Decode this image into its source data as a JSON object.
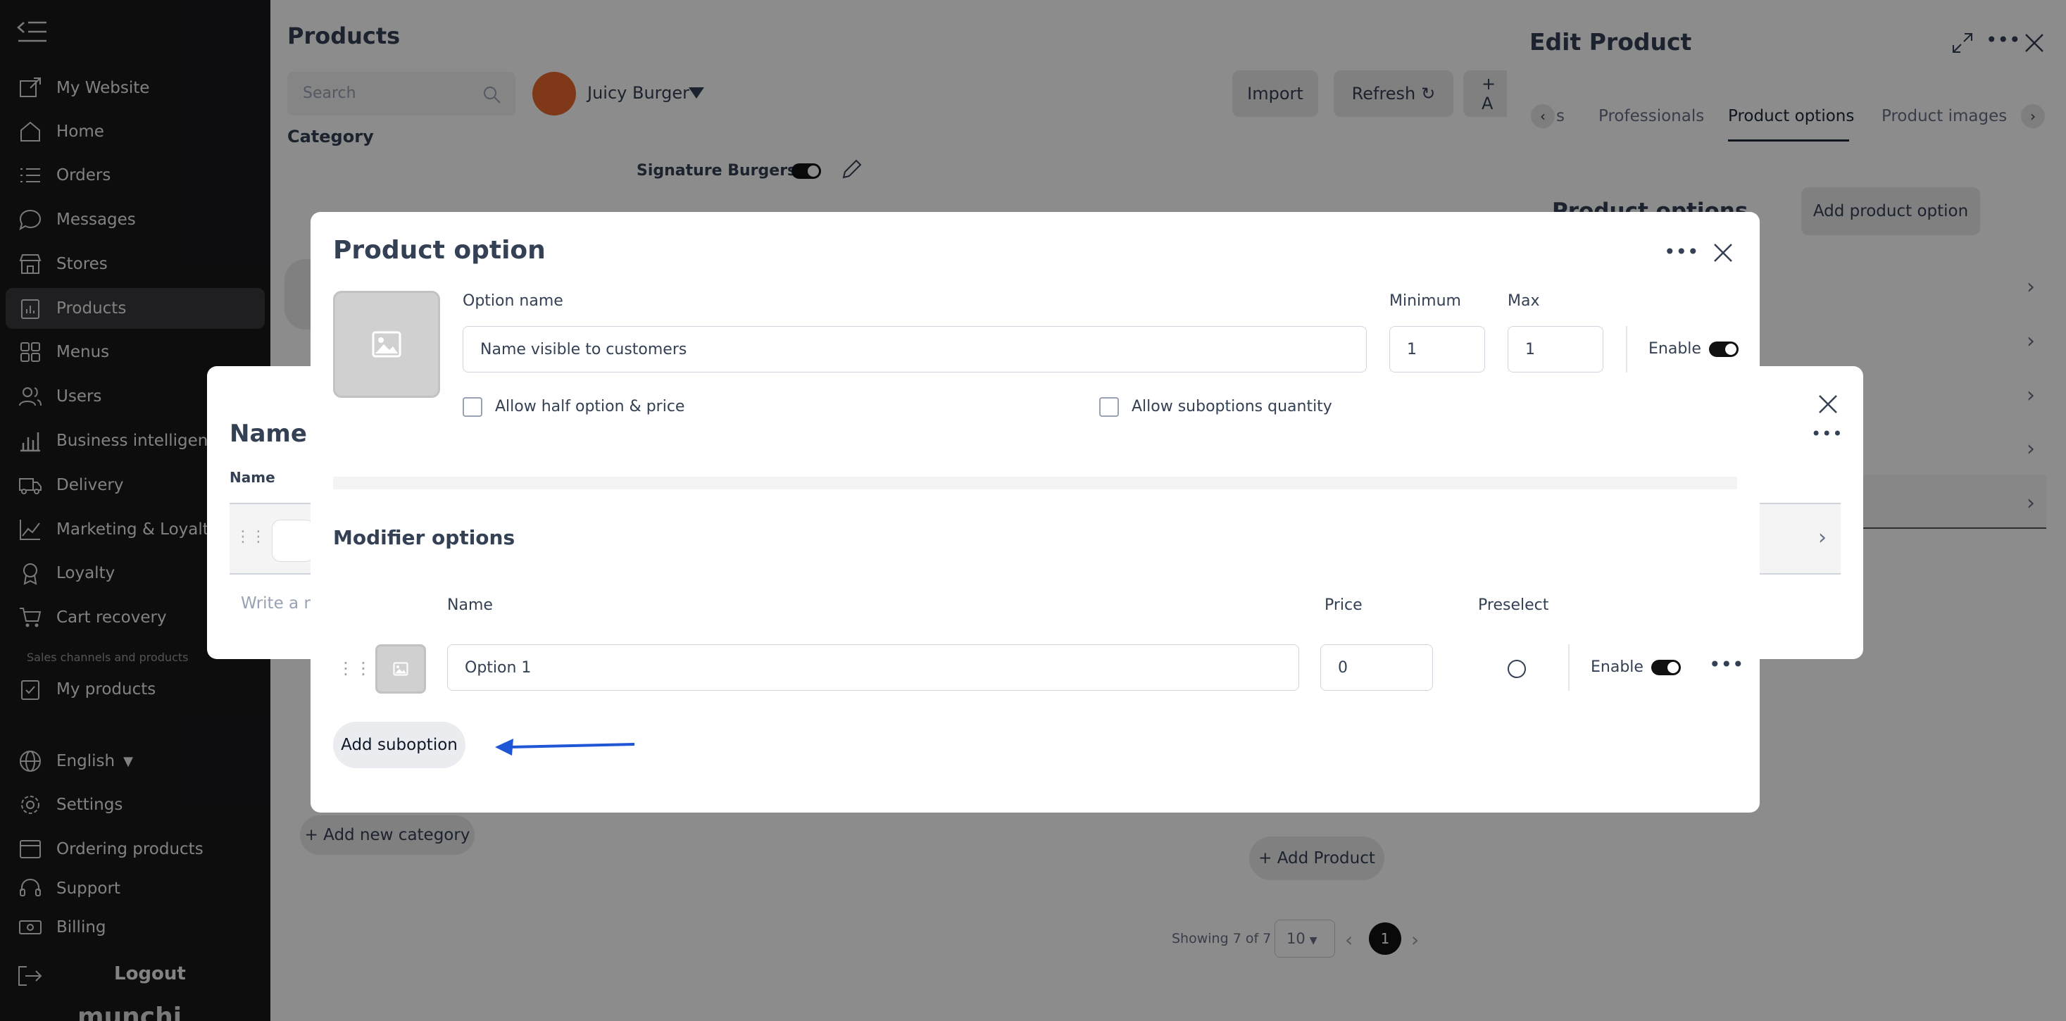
{
  "sidebar": {
    "items": [
      {
        "label": "My Website",
        "icon": "external-link-icon"
      },
      {
        "label": "Home",
        "icon": "home-icon"
      },
      {
        "label": "Orders",
        "icon": "list-icon"
      },
      {
        "label": "Messages",
        "icon": "chat-icon"
      },
      {
        "label": "Stores",
        "icon": "store-icon"
      },
      {
        "label": "Products",
        "icon": "clipboard-icon",
        "active": true
      },
      {
        "label": "Menus",
        "icon": "grid-icon"
      },
      {
        "label": "Users",
        "icon": "users-icon"
      },
      {
        "label": "Business intelligence",
        "icon": "bar-chart-icon"
      },
      {
        "label": "Delivery",
        "icon": "truck-icon"
      },
      {
        "label": "Marketing & Loyalty",
        "icon": "line-chart-icon"
      },
      {
        "label": "Loyalty",
        "icon": "award-icon"
      },
      {
        "label": "Cart recovery",
        "icon": "cart-icon"
      }
    ],
    "section_label": "Sales channels and products",
    "items2": [
      {
        "label": "My products",
        "icon": "clipboard-check-icon"
      },
      {
        "label": "English",
        "icon": "globe-icon"
      },
      {
        "label": "Settings",
        "icon": "gear-icon"
      },
      {
        "label": "Ordering products",
        "icon": "browser-icon"
      },
      {
        "label": "Support",
        "icon": "headset-icon"
      },
      {
        "label": "Billing",
        "icon": "cash-icon"
      }
    ],
    "logout": "Logout",
    "brand": "munchi"
  },
  "page": {
    "title": "Products",
    "search_placeholder": "Search",
    "store_name": "Juicy Burger",
    "import": "Import",
    "refresh": "Refresh",
    "add_partial": "+ A",
    "category_label": "Category",
    "category_name": "Signature Burgers",
    "add_category": "+ Add new category",
    "add_product": "+ Add Product",
    "showing": "Showing 7 of 7",
    "page_size": "10",
    "current_page": "1"
  },
  "panel": {
    "title": "Edit Product",
    "tabs": [
      "s",
      "Professionals",
      "Product options",
      "Product images"
    ],
    "active_tab": "Product options",
    "subtitle": "Product options",
    "add_option": "Add product option"
  },
  "mid_dialog": {
    "title": "Name v",
    "name_label": "Name",
    "write_placeholder": "Write a na"
  },
  "modal": {
    "title": "Product option",
    "option_name_label": "Option name",
    "option_name_value": "Name visible to customers",
    "minimum_label": "Minimum",
    "minimum_value": "1",
    "max_label": "Max",
    "max_value": "1",
    "enable_label": "Enable",
    "allow_half": "Allow half option & price",
    "allow_quantity": "Allow suboptions quantity",
    "modifier_title": "Modifier options",
    "col_name": "Name",
    "col_price": "Price",
    "col_preselect": "Preselect",
    "suboption": {
      "name": "Option 1",
      "price": "0",
      "enable_label": "Enable"
    },
    "add_suboption": "Add suboption"
  },
  "colors": {
    "sidebar": "#18181b",
    "arrow": "#1f56d6",
    "toggle": "#111111",
    "store_avatar": "#e8692c"
  }
}
